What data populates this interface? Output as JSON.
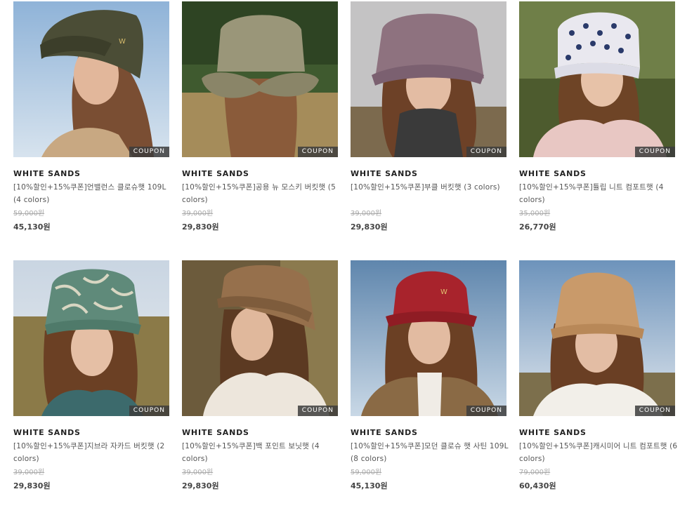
{
  "products": [
    {
      "brand": "WHITE SANDS",
      "name": "[10%할인+15%쿠폰]언밸런스 클로슈햇 109L (4 colors)",
      "original_price": "59,000원",
      "sale_price": "45,130원",
      "badge": "COUPON"
    },
    {
      "brand": "WHITE SANDS",
      "name": "[10%할인+15%쿠폰]공용 뉴 모스키 버킷햇 (5 colors)",
      "original_price": "39,000원",
      "sale_price": "29,830원",
      "badge": "COUPON"
    },
    {
      "brand": "WHITE SANDS",
      "name": "[10%할인+15%쿠폰]부클 버킷햇 (3 colors)",
      "original_price": "39,000원",
      "sale_price": "29,830원",
      "badge": "COUPON"
    },
    {
      "brand": "WHITE SANDS",
      "name": "[10%할인+15%쿠폰]튤립 니트 컴포트햇 (4 colors)",
      "original_price": "35,000원",
      "sale_price": "26,770원",
      "badge": "COUPON"
    },
    {
      "brand": "WHITE SANDS",
      "name": "[10%할인+15%쿠폰]지브라 자카드 버킷햇 (2 colors)",
      "original_price": "39,000원",
      "sale_price": "29,830원",
      "badge": "COUPON"
    },
    {
      "brand": "WHITE SANDS",
      "name": "[10%할인+15%쿠폰]백 포인트 보닛햇 (4 colors)",
      "original_price": "39,000원",
      "sale_price": "29,830원",
      "badge": "COUPON"
    },
    {
      "brand": "WHITE SANDS",
      "name": "[10%할인+15%쿠폰]모던 클로슈 햇 사틴 109L (8 colors)",
      "original_price": "59,000원",
      "sale_price": "45,130원",
      "badge": "COUPON"
    },
    {
      "brand": "WHITE SANDS",
      "name": "[10%할인+15%쿠폰]캐시미어 니트 컴포트햇 (6 colors)",
      "original_price": "79,000원",
      "sale_price": "60,430원",
      "badge": "COUPON"
    }
  ],
  "colors": {
    "strike_price": "#aaaaaa",
    "sale_price": "#444444",
    "coupon_badge": "#3c3c3c"
  }
}
